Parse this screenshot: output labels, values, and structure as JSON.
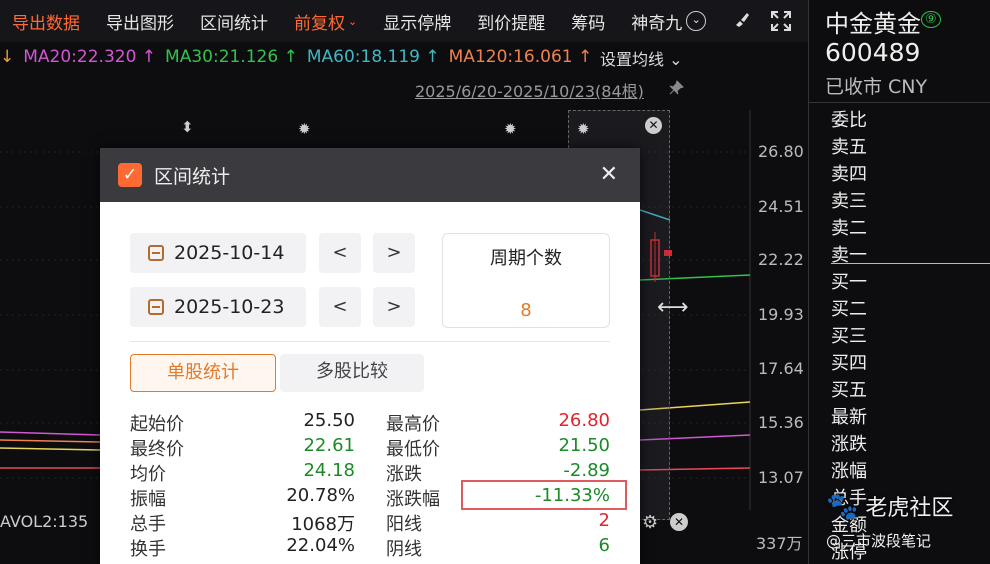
{
  "toolbar": {
    "items": [
      "导出数据",
      "导出图形",
      "区间统计",
      "前复权",
      "显示停牌",
      "到价提醒",
      "筹码",
      "神奇九"
    ],
    "fq_caret": "⌄",
    "magic_glyph": "⌄"
  },
  "ma": {
    "ma20": "MA20:22.320 ↑",
    "ma30": "MA30:21.126 ↑",
    "ma60": "MA60:18.119 ↑",
    "ma120": "MA120:16.061 ↑",
    "settings": "设置均线 ⌄"
  },
  "range": "2025/6/20-2025/10/23(84根)",
  "y_axis": [
    "26.80",
    "24.51",
    "22.22",
    "19.93",
    "17.64",
    "15.36",
    "13.07"
  ],
  "volume": {
    "label": "AVOL2:135",
    "right": "337万"
  },
  "stock": {
    "name": "中金黄金",
    "badge": "⑨",
    "code": "600489",
    "status": "已收市 CNY",
    "rows": [
      "委比",
      "卖五",
      "卖四",
      "卖三",
      "卖二",
      "卖一",
      "买一",
      "买二",
      "买三",
      "买四",
      "买五",
      "最新",
      "涨跌",
      "涨幅",
      "总手",
      "金额",
      "涨停"
    ]
  },
  "watermark": {
    "main": "老虎社区",
    "sub": "@三市波段笔记"
  },
  "dialog": {
    "title": "区间统计",
    "start_date": "2025-10-14",
    "end_date": "2025-10-23",
    "prev": "<",
    "next": ">",
    "period_label": "周期个数",
    "period_value": "8",
    "tab_single": "单股统计",
    "tab_multi": "多股比较",
    "left_stats": [
      {
        "label": "起始价",
        "value": "25.50"
      },
      {
        "label": "最终价",
        "value": "22.61"
      },
      {
        "label": "均价",
        "value": "24.18"
      },
      {
        "label": "振幅",
        "value": "20.78%"
      },
      {
        "label": "总手",
        "value": "1068万"
      },
      {
        "label": "换手",
        "value": "22.04%"
      }
    ],
    "right_stats": [
      {
        "label": "最高价",
        "value": "26.80"
      },
      {
        "label": "最低价",
        "value": "21.50"
      },
      {
        "label": "涨跌",
        "value": "-2.89"
      },
      {
        "label": "涨跌幅",
        "value": "-11.33%"
      },
      {
        "label": "阳线",
        "value": "2"
      },
      {
        "label": "阴线",
        "value": "6"
      }
    ]
  },
  "colors": {
    "accent": "#ff6a33",
    "up": "#e0242f",
    "down": "#1b8a28"
  }
}
